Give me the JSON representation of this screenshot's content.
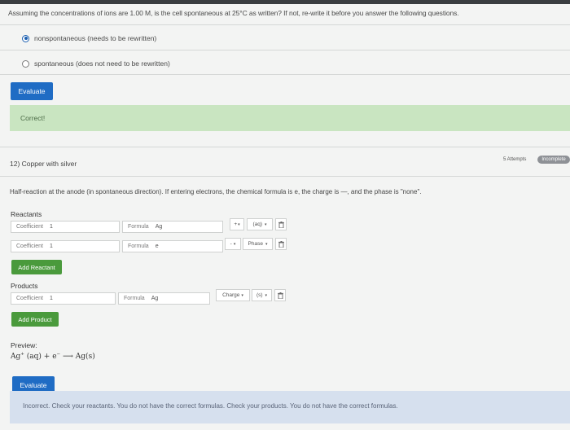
{
  "question": {
    "text": "Assuming the concentrations of ions are 1.00 M, is the cell spontaneous at 25°C as written? If not, re-write it before you answer the following questions.",
    "options": [
      {
        "label": "nonspontaneous (needs to be rewritten)",
        "selected": true
      },
      {
        "label": "spontaneous (does not need to be rewritten)",
        "selected": false
      }
    ],
    "evaluate_label": "Evaluate",
    "feedback": "Correct!"
  },
  "part12": {
    "title": "12) Copper with silver",
    "attempts": "5 Attempts",
    "status_badge": "Incomplete",
    "instructions": "Half-reaction at the anode (in spontaneous direction). If entering electrons, the chemical formula is e, the charge is —, and the phase is \"none\".",
    "reactants_label": "Reactants",
    "reactants": [
      {
        "coef_label": "Coefficient",
        "coef": "1",
        "formula_label": "Formula",
        "formula": "Ag",
        "charge": "+",
        "phase": "(aq)"
      },
      {
        "coef_label": "Coefficient",
        "coef": "1",
        "formula_label": "Formula",
        "formula": "e",
        "charge": "-",
        "phase": "Phase"
      }
    ],
    "add_reactant_label": "Add Reactant",
    "products_label": "Products",
    "products": [
      {
        "coef_label": "Coefficient",
        "coef": "1",
        "formula_label": "Formula",
        "formula": "Ag",
        "charge": "Charge",
        "phase": "(s)"
      }
    ],
    "add_product_label": "Add Product",
    "preview_label": "Preview:",
    "preview": {
      "ag": "Ag",
      "ag_sup": "+",
      "aq": "(aq)",
      "plus": "+",
      "e": "e",
      "e_sup": "−",
      "arrow": "⟶",
      "product": "Ag(s)"
    },
    "evaluate_label": "Evaluate",
    "feedback": "Incorrect. Check your reactants. You do not have the correct formulas. Check your products. You do not have the correct formulas."
  },
  "colors": {
    "accent_blue": "#1f6cc4",
    "add_green": "#4a9a3c",
    "correct_bg": "#c9e5c1",
    "incorrect_bg": "#d6e0ee"
  },
  "icons": {
    "dropdown": "chevron-down-icon",
    "delete": "trash-icon"
  }
}
